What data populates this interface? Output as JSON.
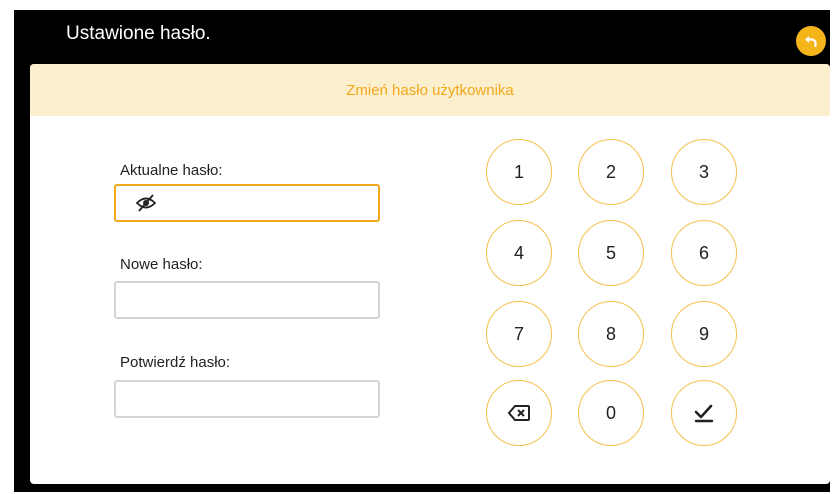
{
  "header": {
    "title": "Ustawione hasło."
  },
  "panel": {
    "title": "Zmień hasło użytkownika"
  },
  "fields": {
    "current_label": "Aktualne hasło:",
    "new_label": "Nowe hasło:",
    "confirm_label": "Potwierdź hasło:"
  },
  "keypad": {
    "keys": [
      "1",
      "2",
      "3",
      "4",
      "5",
      "6",
      "7",
      "8",
      "9",
      "0"
    ]
  },
  "colors": {
    "accent": "#f5b51a",
    "header_band": "#fcefce",
    "header_text": "#f2a81b",
    "background": "#000000"
  },
  "icons": {
    "back": "back-arrow-icon",
    "visibility": "eye-off-icon",
    "delete": "backspace-icon",
    "confirm": "check-icon"
  }
}
